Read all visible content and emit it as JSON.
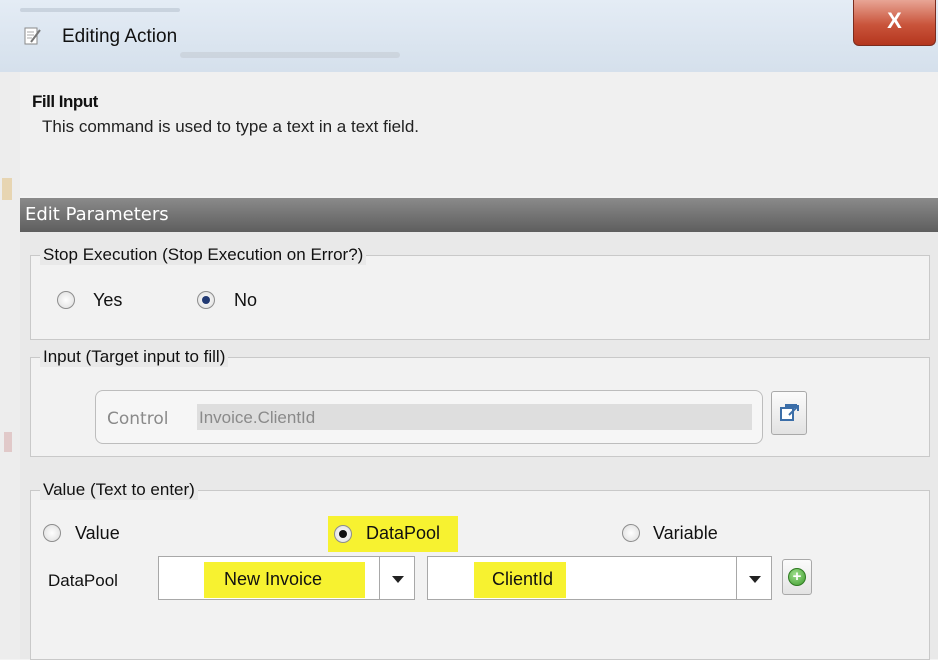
{
  "window": {
    "title": "Editing Action",
    "close_label": "X",
    "icon": "edit-document-icon"
  },
  "command": {
    "name": "Fill Input",
    "description": "This command is used to type a text in a text field."
  },
  "edit_parameters_label": "Edit Parameters",
  "stop_execution": {
    "legend": "Stop Execution (Stop Execution on Error?)",
    "options": [
      "Yes",
      "No"
    ],
    "selected": "No"
  },
  "input": {
    "legend": "Input (Target input to fill)",
    "prefix": "Control",
    "value": "Invoice.ClientId",
    "pick_icon": "open-window-icon"
  },
  "value_group": {
    "legend": "Value (Text to enter)",
    "options": [
      "Value",
      "DataPool",
      "Variable"
    ],
    "selected": "DataPool",
    "row_label": "DataPool",
    "datapool_selected": "New Invoice",
    "column_selected": "ClientId",
    "add_icon": "add-green-icon",
    "highlight_color": "#f7f230"
  }
}
